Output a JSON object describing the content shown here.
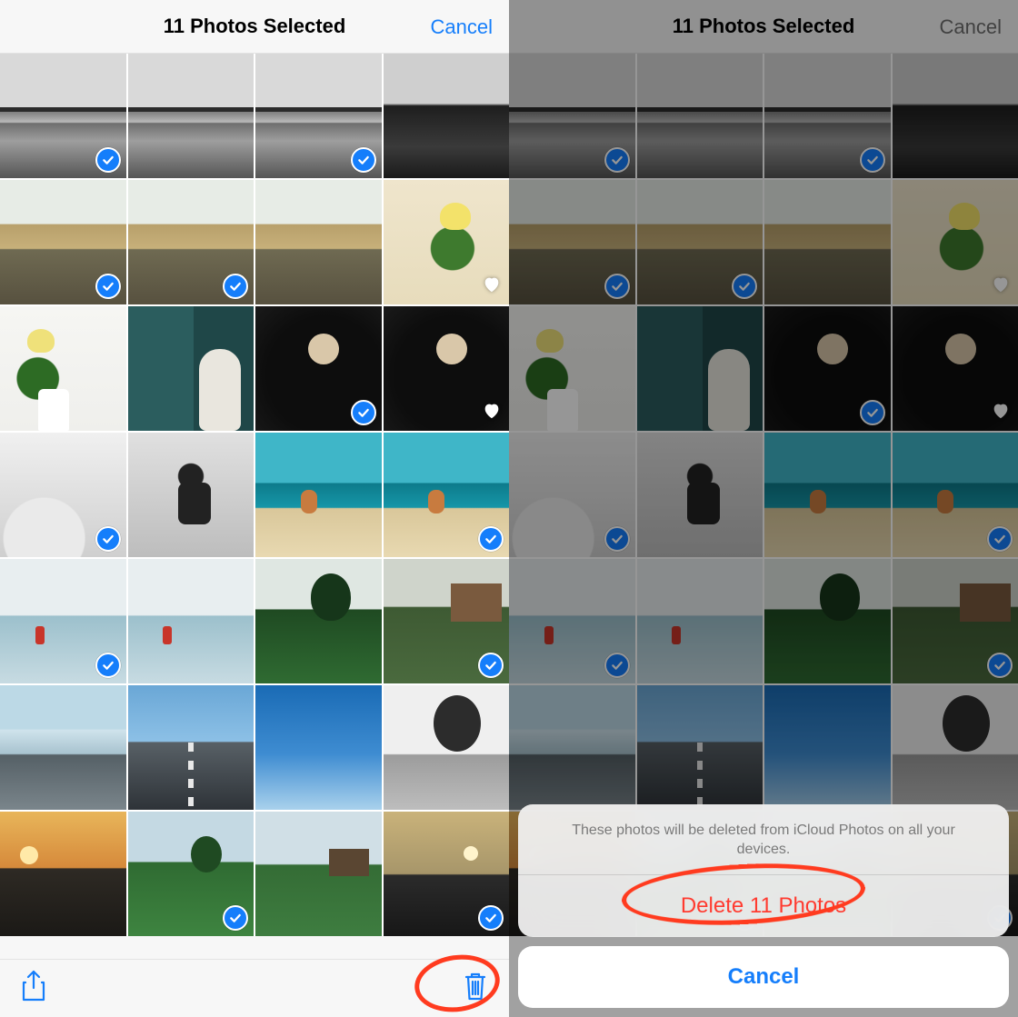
{
  "colors": {
    "tint": "#157efb",
    "destructive": "#ff3b30",
    "annotation": "#ff3b1f"
  },
  "nav": {
    "title": "11 Photos Selected",
    "cancel": "Cancel"
  },
  "toolbar": {
    "share_icon": "share-icon",
    "trash_icon": "trash-icon"
  },
  "actionsheet": {
    "message": "These photos will be deleted from iCloud Photos on all your devices.",
    "delete": "Delete 11 Photos",
    "cancel": "Cancel"
  },
  "grid": {
    "rows": 7,
    "cols": 4,
    "cells": [
      {
        "thumb": "th-ocean-bw",
        "selected": true,
        "favorite": false
      },
      {
        "thumb": "th-ocean-bw",
        "selected": false,
        "favorite": false
      },
      {
        "thumb": "th-ocean-bw",
        "selected": true,
        "favorite": false
      },
      {
        "thumb": "th-ocean-dark",
        "selected": false,
        "favorite": false
      },
      {
        "thumb": "th-field",
        "selected": true,
        "favorite": false
      },
      {
        "thumb": "th-field",
        "selected": true,
        "favorite": false
      },
      {
        "thumb": "th-field",
        "selected": false,
        "favorite": false
      },
      {
        "thumb": "th-tulips-beige",
        "selected": false,
        "favorite": true
      },
      {
        "thumb": "th-tulips-white",
        "selected": false,
        "favorite": false
      },
      {
        "thumb": "th-door-dog",
        "selected": false,
        "favorite": false
      },
      {
        "thumb": "th-kid-dark",
        "selected": true,
        "favorite": false
      },
      {
        "thumb": "th-kid-dark",
        "selected": false,
        "favorite": true
      },
      {
        "thumb": "th-kid-bw",
        "selected": true,
        "favorite": false
      },
      {
        "thumb": "th-jump-bw",
        "selected": false,
        "favorite": false
      },
      {
        "thumb": "th-beach",
        "selected": false,
        "favorite": false
      },
      {
        "thumb": "th-beach",
        "selected": true,
        "favorite": false
      },
      {
        "thumb": "th-shore-red",
        "selected": true,
        "favorite": false
      },
      {
        "thumb": "th-shore-red",
        "selected": false,
        "favorite": false
      },
      {
        "thumb": "th-tree-hill",
        "selected": false,
        "favorite": false
      },
      {
        "thumb": "th-cottage",
        "selected": true,
        "favorite": false
      },
      {
        "thumb": "th-road-sea",
        "selected": false,
        "favorite": false
      },
      {
        "thumb": "th-road",
        "selected": false,
        "favorite": false
      },
      {
        "thumb": "th-sky-blue",
        "selected": false,
        "favorite": false
      },
      {
        "thumb": "th-tree-bw",
        "selected": false,
        "favorite": false
      },
      {
        "thumb": "th-sunset",
        "selected": false,
        "favorite": false
      },
      {
        "thumb": "th-green1",
        "selected": true,
        "favorite": false
      },
      {
        "thumb": "th-green2",
        "selected": false,
        "favorite": false
      },
      {
        "thumb": "th-sunset2",
        "selected": true,
        "favorite": false
      }
    ]
  }
}
